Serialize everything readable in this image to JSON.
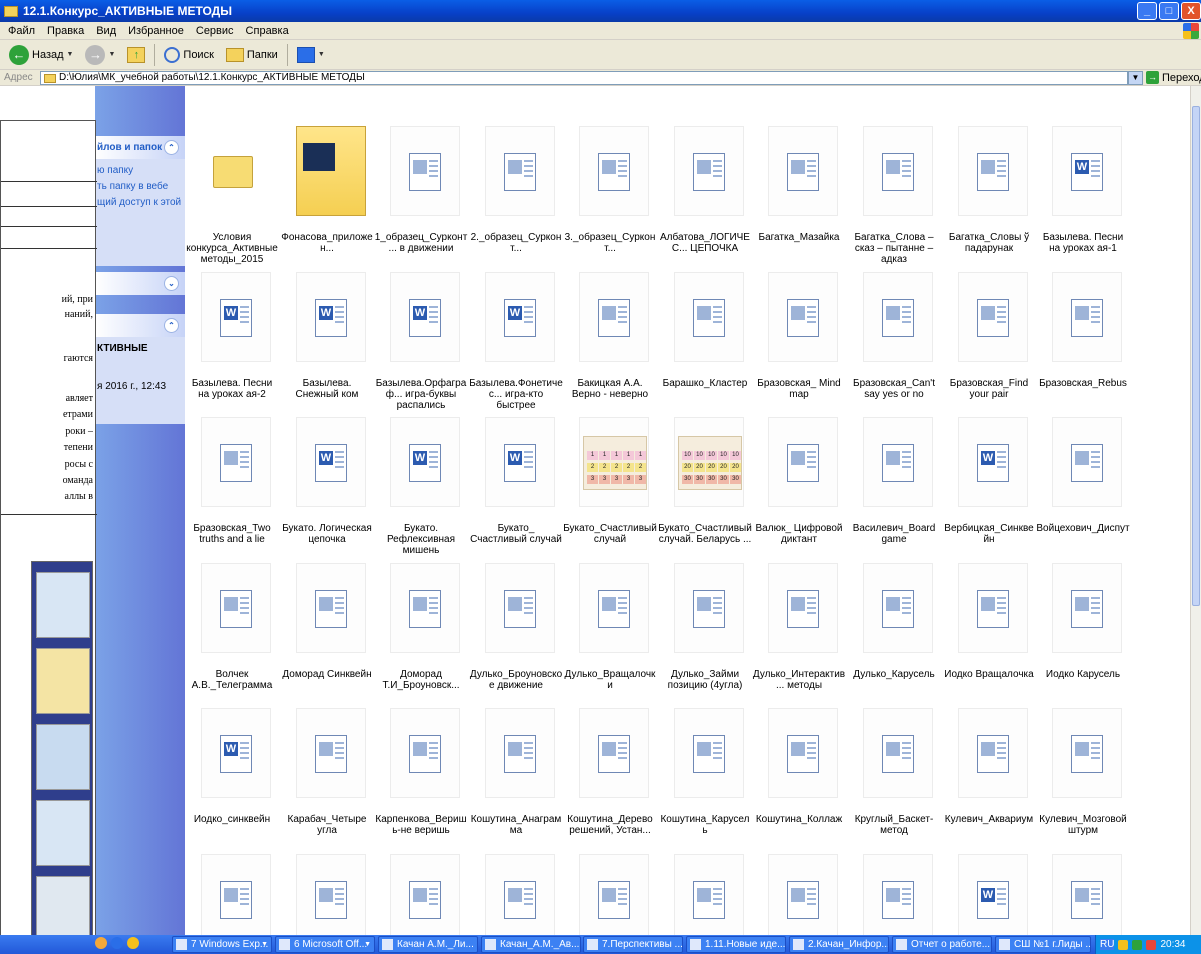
{
  "window": {
    "title": "12.1.Конкурс_АКТИВНЫЕ МЕТОДЫ",
    "buttons": [
      "_",
      "□",
      "X"
    ]
  },
  "menu": [
    "Файл",
    "Правка",
    "Вид",
    "Избранное",
    "Сервис",
    "Справка"
  ],
  "toolbar": {
    "back": "Назад",
    "search": "Поиск",
    "folders": "Папки"
  },
  "address": {
    "label": "Адрес",
    "path": "D:\\Юлия\\МК_учебной работы\\12.1.Конкурс_АКТИВНЫЕ МЕТОДЫ",
    "go": "Переход"
  },
  "taskpane": {
    "panel1_title": "йлов и папок",
    "panel1_items": [
      "ю папку",
      "ть папку в вебе",
      "щий доступ к этой"
    ],
    "panel3_title": "КТИВНЫЕ",
    "panel3_date": "я 2016 г., 12:43"
  },
  "doc": {
    "lines": [
      "ий, при",
      "наний,",
      "гаются",
      "авляет",
      "етрами",
      "роки –",
      "тепени",
      "росы с",
      "оманда",
      "аллы в"
    ]
  },
  "files": [
    {
      "label": "Условия конкурса_Активные методы_2015",
      "type": "folder"
    },
    {
      "label": "Фонасова_приложен...",
      "type": "folder-big"
    },
    {
      "label": "1_образец_Сурконт... в движении",
      "type": "doc"
    },
    {
      "label": "2._образец_Сурконт...",
      "type": "doc"
    },
    {
      "label": "3._образец_Сурконт...",
      "type": "doc"
    },
    {
      "label": "Албатова_ЛОГИЧЕС... ЦЕПОЧКА",
      "type": "doc"
    },
    {
      "label": "Багатка_Мазайка",
      "type": "doc"
    },
    {
      "label": "Багатка_Слова – сказ – пытанне – адказ",
      "type": "doc"
    },
    {
      "label": "Багатка_Словы ў падарунак",
      "type": "doc"
    },
    {
      "label": "Базылева. Песни на уроках ая-1",
      "type": "word"
    },
    {
      "label": "Базылева. Песни на уроках ая-2",
      "type": "word"
    },
    {
      "label": "Базылева. Снежный ком",
      "type": "word"
    },
    {
      "label": "Базылева.Орфаграф... игра-буквы распались",
      "type": "word"
    },
    {
      "label": "Базылева.Фонетичес... игра-кто быстрее",
      "type": "word"
    },
    {
      "label": "Бакицкая А.А. Верно - неверно",
      "type": "doc"
    },
    {
      "label": "Барашко_Кластер",
      "type": "doc"
    },
    {
      "label": "Бразовская_ Mind map",
      "type": "doc"
    },
    {
      "label": "Бразовская_Can't say yes or no",
      "type": "doc"
    },
    {
      "label": "Бразовская_Find your pair",
      "type": "doc"
    },
    {
      "label": "Бразовская_Rebus",
      "type": "doc"
    },
    {
      "label": "Бразовская_Two truths and a lie",
      "type": "doc"
    },
    {
      "label": "Букато. Логическая цепочка",
      "type": "word"
    },
    {
      "label": "Букато. Рефлексивная мишень",
      "type": "word"
    },
    {
      "label": "Букато_ Счастливый случай",
      "type": "word"
    },
    {
      "label": "Букато_Счастливый случай",
      "type": "grid1"
    },
    {
      "label": "Букато_Счастливый случай. Беларусь ...",
      "type": "grid2"
    },
    {
      "label": "Валюк_ Цифровой диктант",
      "type": "doc"
    },
    {
      "label": "Василевич_Board game",
      "type": "doc"
    },
    {
      "label": "Вербицкая_Синквейн",
      "type": "word"
    },
    {
      "label": "Войцехович_Диспут",
      "type": "doc"
    },
    {
      "label": "Волчек А.В._Телеграмма",
      "type": "doc"
    },
    {
      "label": "Доморад Синквейн",
      "type": "doc"
    },
    {
      "label": "Доморад Т.И_Броуновск...",
      "type": "doc"
    },
    {
      "label": "Дулько_Броуновское движение",
      "type": "doc"
    },
    {
      "label": "Дулько_Вращалочки",
      "type": "doc"
    },
    {
      "label": "Дулько_Займи позицию (4угла)",
      "type": "doc"
    },
    {
      "label": "Дулько_Интерактив... методы",
      "type": "doc"
    },
    {
      "label": "Дулько_Карусель",
      "type": "doc"
    },
    {
      "label": "Иодко Вращалочка",
      "type": "doc"
    },
    {
      "label": "Иодко Карусель",
      "type": "doc"
    },
    {
      "label": "Иодко_синквейн",
      "type": "word"
    },
    {
      "label": "Карабач_Четыре угла",
      "type": "doc"
    },
    {
      "label": "Карпенкова_Веришь-не веришь",
      "type": "doc"
    },
    {
      "label": "Кошутина_Анаграмма",
      "type": "doc"
    },
    {
      "label": "Кошутина_Дерево решений, Устан...",
      "type": "doc"
    },
    {
      "label": "Кошутина_Карусель",
      "type": "doc"
    },
    {
      "label": "Кошутина_Коллаж",
      "type": "doc"
    },
    {
      "label": "Круглый_Баскет-метод",
      "type": "doc"
    },
    {
      "label": "Кулевич_Аквариум",
      "type": "doc"
    },
    {
      "label": "Кулевич_Мозговой штурм",
      "type": "doc"
    },
    {
      "label": "",
      "type": "doc"
    },
    {
      "label": "",
      "type": "doc"
    },
    {
      "label": "",
      "type": "doc"
    },
    {
      "label": "",
      "type": "doc"
    },
    {
      "label": "",
      "type": "doc"
    },
    {
      "label": "",
      "type": "doc"
    },
    {
      "label": "",
      "type": "doc"
    },
    {
      "label": "",
      "type": "doc"
    },
    {
      "label": "",
      "type": "word"
    },
    {
      "label": "",
      "type": "doc"
    }
  ],
  "grid1_values": [
    "1",
    "1",
    "1",
    "1",
    "1",
    "2",
    "2",
    "2",
    "2",
    "2",
    "3",
    "3",
    "3",
    "3",
    "3"
  ],
  "grid2_values": [
    "10",
    "10",
    "10",
    "10",
    "10",
    "20",
    "20",
    "20",
    "20",
    "20",
    "30",
    "30",
    "30",
    "30",
    "30"
  ],
  "taskbar": {
    "tasks": [
      {
        "label": "7 Windows Exp...",
        "group": true
      },
      {
        "label": "6 Microsoft Off...",
        "group": true
      },
      {
        "label": "Качан А.М._Ли...",
        "group": false
      },
      {
        "label": "Качан_А.М._Ав...",
        "group": false
      },
      {
        "label": "7.Перспективы ...",
        "group": false
      },
      {
        "label": "1.11.Новые иде...",
        "group": false
      },
      {
        "label": "2.Качан_Инфор...",
        "group": false
      },
      {
        "label": "Отчет о работе...",
        "group": false
      },
      {
        "label": "СШ №1 г.Лиды ...",
        "group": false
      }
    ],
    "lang": "RU",
    "clock": "20:34"
  }
}
